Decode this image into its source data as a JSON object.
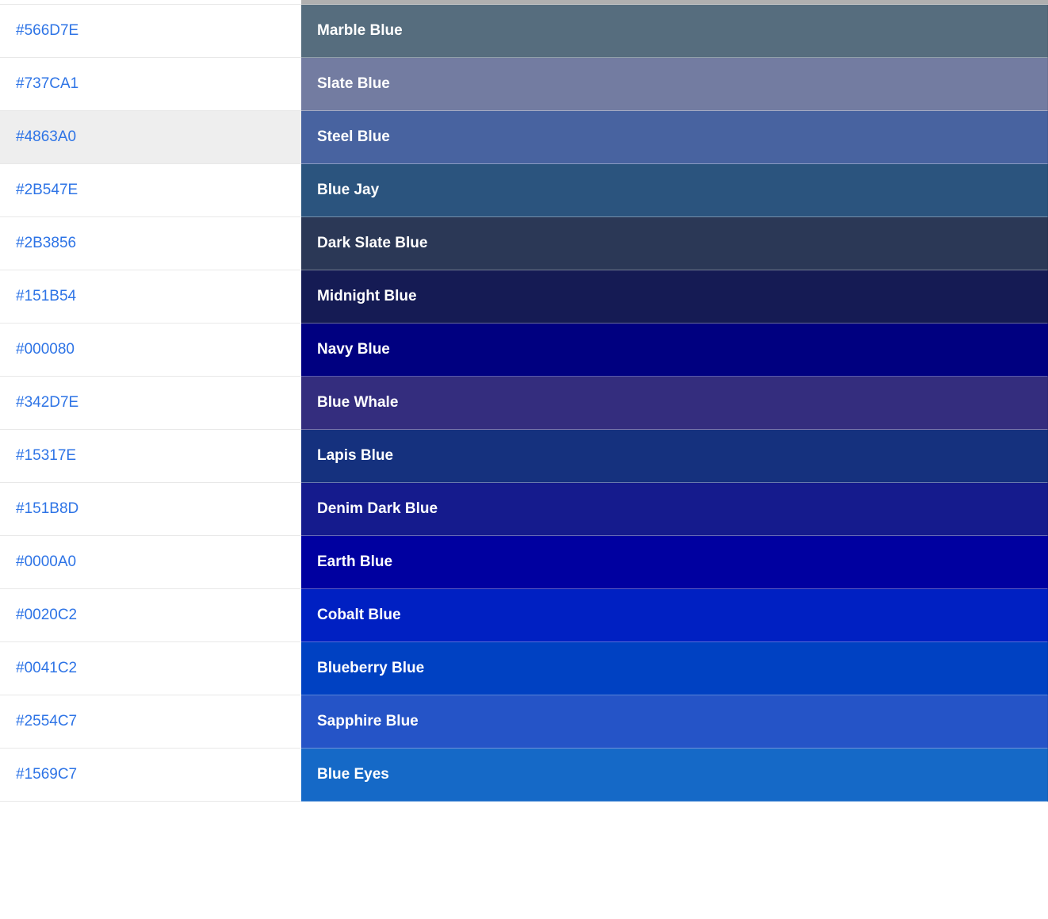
{
  "colors": [
    {
      "hex": "#566D7E",
      "name": "Marble Blue",
      "bg": "#566D7E",
      "highlighted": false
    },
    {
      "hex": "#737CA1",
      "name": "Slate Blue",
      "bg": "#737CA1",
      "highlighted": false
    },
    {
      "hex": "#4863A0",
      "name": "Steel Blue",
      "bg": "#4863A0",
      "highlighted": true
    },
    {
      "hex": "#2B547E",
      "name": "Blue Jay",
      "bg": "#2B547E",
      "highlighted": false
    },
    {
      "hex": "#2B3856",
      "name": "Dark Slate Blue",
      "bg": "#2B3856",
      "highlighted": false
    },
    {
      "hex": "#151B54",
      "name": "Midnight Blue",
      "bg": "#151B54",
      "highlighted": false
    },
    {
      "hex": "#000080",
      "name": "Navy Blue",
      "bg": "#000080",
      "highlighted": false
    },
    {
      "hex": "#342D7E",
      "name": "Blue Whale",
      "bg": "#342D7E",
      "highlighted": false
    },
    {
      "hex": "#15317E",
      "name": "Lapis Blue",
      "bg": "#15317E",
      "highlighted": false
    },
    {
      "hex": "#151B8D",
      "name": "Denim Dark Blue",
      "bg": "#151B8D",
      "highlighted": false
    },
    {
      "hex": "#0000A0",
      "name": "Earth Blue",
      "bg": "#0000A0",
      "highlighted": false
    },
    {
      "hex": "#0020C2",
      "name": "Cobalt Blue",
      "bg": "#0020C2",
      "highlighted": false
    },
    {
      "hex": "#0041C2",
      "name": "Blueberry Blue",
      "bg": "#0041C2",
      "highlighted": false
    },
    {
      "hex": "#2554C7",
      "name": "Sapphire Blue",
      "bg": "#2554C7",
      "highlighted": false
    },
    {
      "hex": "#1569C7",
      "name": "Blue Eyes",
      "bg": "#1569C7",
      "highlighted": false
    }
  ]
}
